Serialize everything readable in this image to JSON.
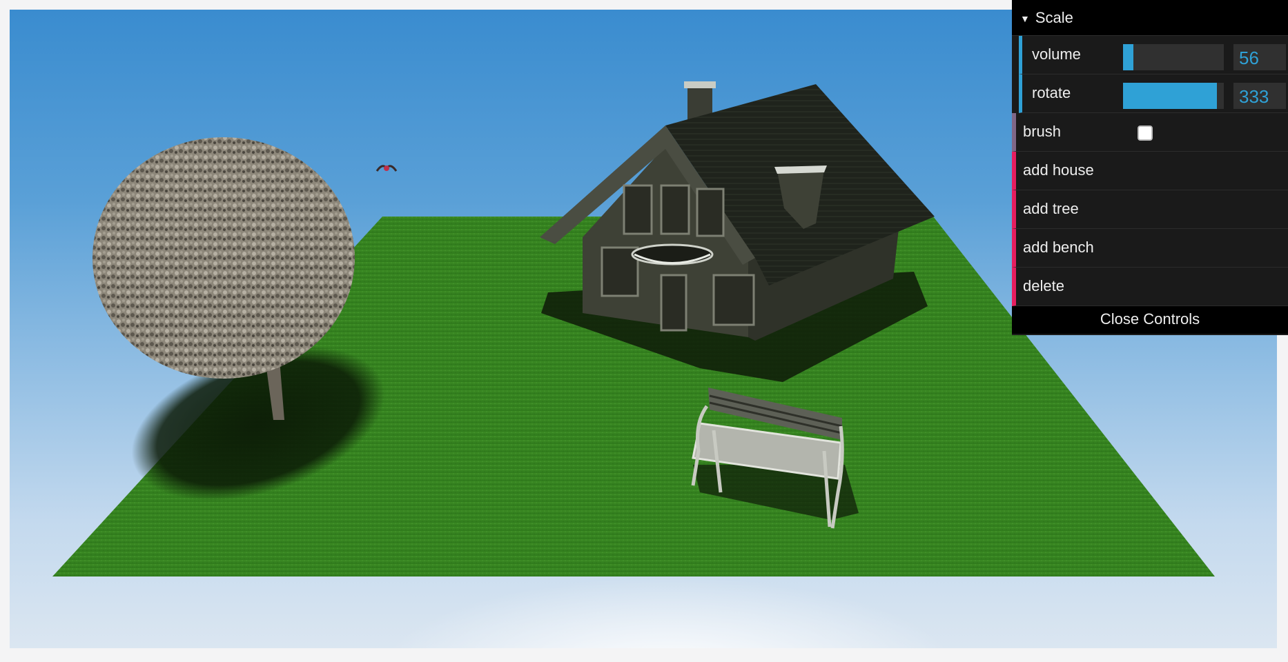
{
  "gui": {
    "folder_title": "Scale",
    "volume": {
      "label": "volume",
      "value": "56",
      "fraction": 0.1
    },
    "rotate": {
      "label": "rotate",
      "value": "333",
      "fraction": 0.93
    },
    "brush": {
      "label": "brush",
      "checked": false
    },
    "actions": [
      "add house",
      "add tree",
      "add bench",
      "delete"
    ],
    "close_label": "Close Controls"
  },
  "colors": {
    "accent_number": "#2fa1d6",
    "accent_function": "#e61d5f",
    "accent_boolean": "#806787",
    "grass": "#3f8f28"
  },
  "scene": {
    "objects": [
      "tree",
      "house",
      "bench",
      "bird"
    ]
  }
}
